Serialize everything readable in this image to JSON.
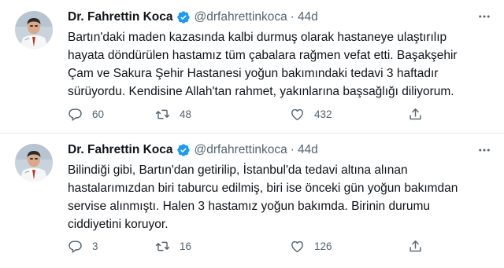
{
  "tweets": [
    {
      "author_name": "Dr. Fahrettin Koca",
      "handle": "@drfahrettinkoca",
      "separator": "·",
      "time": "44d",
      "lines": [
        "Bartın'daki maden kazasında kalbi durmuş olarak hastaneye ulaştırılıp",
        "hayata döndürülen hastamız tüm çabalara rağmen vefat etti. Başakşehir",
        "Çam ve Sakura Şehir Hastanesi yoğun bakımındaki tedavi 3 haftadır",
        "sürüyordu. Kendisine Allah'tan rahmet, yakınlarına başsağlığı diliyorum."
      ],
      "replies": "60",
      "retweets": "48",
      "likes": "432"
    },
    {
      "author_name": "Dr. Fahrettin Koca",
      "handle": "@drfahrettinkoca",
      "separator": "·",
      "time": "44d",
      "lines": [
        "Bilindiği gibi, Bartın'dan getirilip, İstanbul'da tedavi altına alınan",
        "hastalarımızdan biri taburcu edilmiş, biri ise önceki gün yoğun bakımdan",
        "servise alınmıştı. Halen 3 hastamız yoğun bakımda. Birinin durumu",
        "ciddiyetini koruyor."
      ],
      "replies": "3",
      "retweets": "16",
      "likes": "126"
    }
  ],
  "icons": {
    "verified": "verified-badge-icon",
    "more": "more-options-icon",
    "reply": "reply-icon",
    "retweet": "retweet-icon",
    "like": "like-icon",
    "share": "share-icon"
  },
  "colors": {
    "verified_blue": "#1d9bf0",
    "muted_text": "#536471",
    "primary_text": "#0f1419",
    "divider": "#e6ecf0"
  }
}
